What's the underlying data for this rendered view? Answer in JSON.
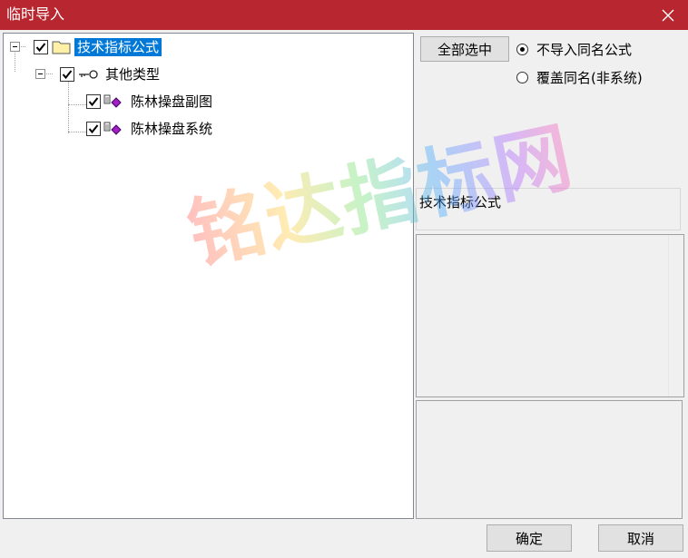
{
  "window": {
    "title": "临时导入"
  },
  "tree": {
    "root": {
      "label": "技术指标公式"
    },
    "group": {
      "label": "其他类型"
    },
    "items": [
      {
        "label": "陈林操盘副图"
      },
      {
        "label": "陈林操盘系统"
      }
    ]
  },
  "controls": {
    "select_all": "全部选中",
    "radio_options": [
      {
        "label": "不导入同名公式",
        "checked": true
      },
      {
        "label": "覆盖同名(非系统)",
        "checked": false
      }
    ]
  },
  "info": {
    "label": "技术指标公式"
  },
  "footer": {
    "ok": "确定",
    "cancel": "取消"
  },
  "watermark": {
    "text": "铭达指标网"
  },
  "colors": {
    "titlebar": "#b8262f",
    "selection": "#0078d7"
  }
}
